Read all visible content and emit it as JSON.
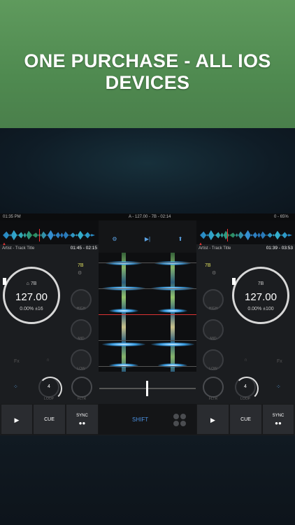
{
  "banner": {
    "headline": "ONE PURCHASE - ALL IOS DEVICES",
    "background_color": "#5a955a"
  },
  "status_bar": {
    "time": "01:35 PM",
    "center_info": "A - 127.00 - 7B - 02:14",
    "battery": "0 - 65%"
  },
  "deck_left": {
    "track_title": "Artist - Track Title",
    "time": "01:45 - 02:15",
    "key": "7B",
    "bpm": "127.00",
    "pitch": "0.00%  ±16",
    "key_small": "7B",
    "eq_labels": [
      "HIGH",
      "MID",
      "LOW"
    ],
    "fx_label": "Fx",
    "loop_value": "4",
    "loop_label": "LOOP",
    "filter_label": "FLTR",
    "cue_label": "CUE",
    "sync_label": "SYNC"
  },
  "deck_right": {
    "track_title": "Artist - Track Title",
    "time": "01:39 - 03:53",
    "key": "7B",
    "bpm": "127.00",
    "pitch": "0.00%  ±100",
    "key_small": "7B",
    "eq_labels": [
      "HIGH",
      "MID",
      "LOW"
    ],
    "fx_label": "Fx",
    "loop_value": "4",
    "loop_label": "LOOP",
    "filter_label": "FLTR",
    "cue_label": "CUE",
    "sync_label": "SYNC"
  },
  "center": {
    "shift_label": "SHIFT",
    "accent_color": "#4a90e0"
  },
  "icons": [
    "gear-icon",
    "play-skip-icon",
    "upload-icon",
    "grid-icon",
    "play-icon",
    "headphones-icon",
    "home-icon",
    "pads-icon"
  ]
}
